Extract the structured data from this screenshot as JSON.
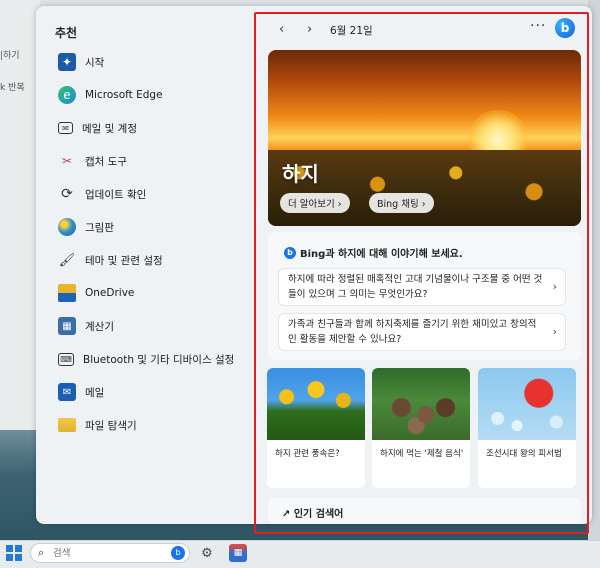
{
  "background": {
    "left_snippets": [
      "|하기",
      "k 반복"
    ]
  },
  "start_menu": {
    "section_title": "추천",
    "items": [
      {
        "label": "시작",
        "icon": "start-tips-icon",
        "color": "#1e5aa8"
      },
      {
        "label": "Microsoft Edge",
        "icon": "edge-icon",
        "color": "#1b8fd6"
      },
      {
        "label": "메일 및 계정",
        "icon": "mail-icon",
        "color": "#333333"
      },
      {
        "label": "캡처 도구",
        "icon": "snipping-tool-icon",
        "color": "#c23a7a"
      },
      {
        "label": "업데이트 확인",
        "icon": "refresh-icon",
        "color": "#333333"
      },
      {
        "label": "그림판",
        "icon": "paint-icon",
        "color": "#2d8bd0"
      },
      {
        "label": "테마 및 관련 설정",
        "icon": "brush-icon",
        "color": "#333333"
      },
      {
        "label": "OneDrive",
        "icon": "onedrive-icon",
        "color": "#1e63b8"
      },
      {
        "label": "계산기",
        "icon": "calculator-icon",
        "color": "#3a6ea8"
      },
      {
        "label": "Bluetooth 및 기타 디바이스 설정",
        "icon": "devices-icon",
        "color": "#333333"
      },
      {
        "label": "메일",
        "icon": "mail-app-icon",
        "color": "#1a5fb4"
      },
      {
        "label": "파일 탐색기",
        "icon": "folder-icon",
        "color": "#e5b22a"
      }
    ]
  },
  "widget": {
    "nav_prev": "‹",
    "nav_next": "›",
    "date": "6월 21일",
    "more": "···",
    "bing_logo": "b",
    "hero": {
      "title": "하지",
      "learn_more": "더 알아보기 ›",
      "bing_chat": "Bing 채팅 ›"
    },
    "prompts": {
      "heading": "Bing과 하지에 대해 이야기해 보세요.",
      "items": [
        {
          "text": "하지에 따라 정렬된 매혹적인 고대 기념물이나 구조물 중 어떤 것들이 있으며 그 의미는 무엇인가요?"
        },
        {
          "text": "가족과 친구들과 함께 하지축제를 즐기기 위한 재미있고 창의적인 활동을 제안할 수 있나요?"
        }
      ],
      "chevron": "›"
    },
    "cards": [
      {
        "caption": "하지 관련 풍속은?"
      },
      {
        "caption": "하지에 먹는 '제철 음식'"
      },
      {
        "caption": "조선시대 왕의 피서법"
      }
    ],
    "popular_searches": "↗ 인기 검색어"
  },
  "taskbar": {
    "search_placeholder": "검색",
    "search_bing": "b"
  }
}
